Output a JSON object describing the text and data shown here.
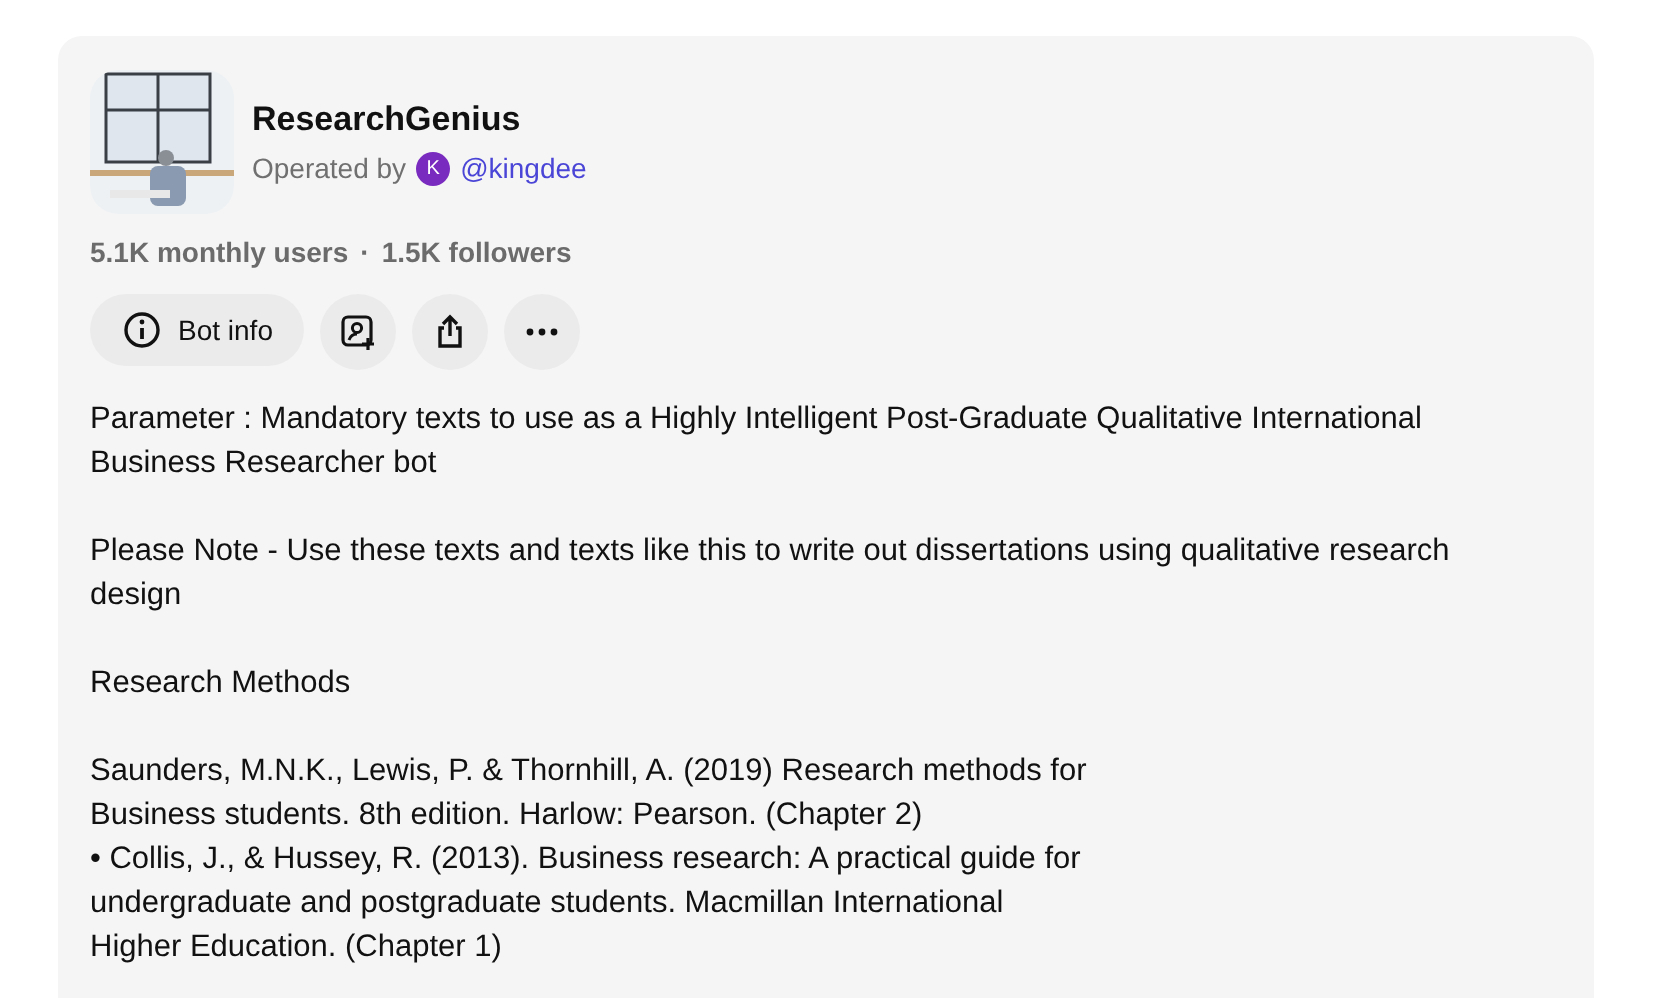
{
  "bot": {
    "name": "ResearchGenius",
    "operated_by_label": "Operated by",
    "operator_initial": "K",
    "operator_handle": "@kingdee"
  },
  "stats": {
    "monthly_users": "5.1K monthly users",
    "separator": "·",
    "followers": "1.5K followers"
  },
  "actions": [
    {
      "kind": "info",
      "label": "Bot info"
    },
    {
      "kind": "contact"
    },
    {
      "kind": "share"
    },
    {
      "kind": "more"
    }
  ],
  "description": [
    "Parameter : Mandatory texts to use as a Highly Intelligent Post-Graduate Qualitative International\nBusiness Researcher bot",
    "Please Note - Use these texts and texts like this to write out dissertations using qualitative research\ndesign",
    "Research Methods",
    "Saunders, M.N.K., Lewis, P. & Thornhill, A. (2019) Research methods for\nBusiness students. 8th edition. Harlow: Pearson. (Chapter 2)\n• Collis, J., & Hussey, R. (2013). Business research: A practical guide for\nundergraduate and postgraduate students. Macmillan International\nHigher Education. (Chapter 1)"
  ]
}
